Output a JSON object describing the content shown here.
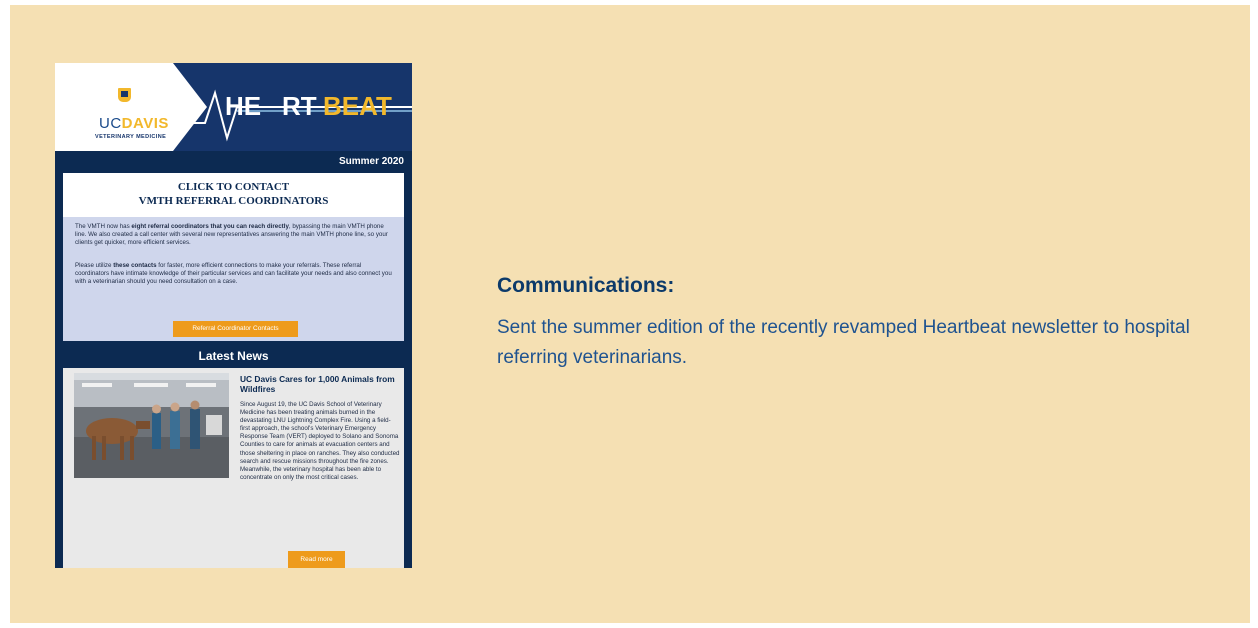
{
  "newsletter": {
    "brand": {
      "uc": "UC",
      "davis": "DAVIS",
      "subtitle": "VETERINARY MEDICINE"
    },
    "title": {
      "part1": "HE",
      "part2": "RT",
      "part3": "BEAT"
    },
    "season": "Summer 2020",
    "contact_heading": {
      "line1": "CLICK TO CONTACT",
      "line2": "VMTH REFERRAL COORDINATORS"
    },
    "contact_p1": {
      "before": "The VMTH now has ",
      "bold": "eight referral coordinators that you can reach directly",
      "after": ", bypassing the main VMTH phone line. We also created a call center with several new representatives answering the main VMTH phone line, so your clients get quicker, more efficient services."
    },
    "contact_p2": {
      "before": "Please utilize ",
      "bold": "these contacts",
      "after": " for faster, more efficient connections to make your referrals. These referral coordinators have intimate knowledge of their particular services and can facilitate your needs and also connect you with a veterinarian should you need consultation on a case."
    },
    "contacts_button": "Referral Coordinator Contacts",
    "news_heading": "Latest News",
    "article": {
      "title": "UC Davis Cares for 1,000 Animals from Wildfires",
      "body": "Since August 19, the UC Davis School of Veterinary Medicine has been treating animals burned in the devastating LNU Lightning Complex Fire. Using a field-first approach, the school's Veterinary Emergency Response Team (VERT) deployed to Solano and Sonoma Counties to care for animals at evacuation centers and those sheltering in place on ranches. They also conducted search and rescue missions throughout the fire zones. Meanwhile, the veterinary hospital has been able to concentrate on only the most critical cases.",
      "read_more": "Read more"
    },
    "colors": {
      "navy": "#0c2a52",
      "gold": "#f2b82c",
      "orange": "#ee9b1c",
      "light_blue": "#cfd6ec"
    }
  },
  "communications": {
    "title": "Communications:",
    "text": "Sent the summer edition of the recently revamped Heartbeat newsletter to hospital referring veterinarians."
  },
  "colors": {
    "background": "#f5e0b3",
    "heading": "#0c3a6a",
    "body_text": "#1f5390"
  }
}
